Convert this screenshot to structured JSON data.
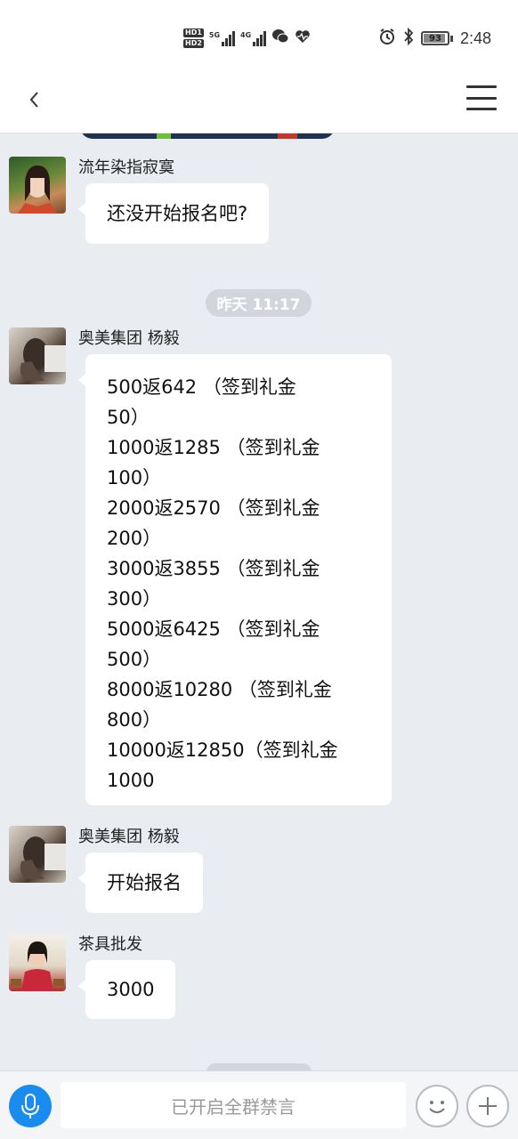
{
  "status_bar": {
    "hd1": "HD1",
    "hd2": "HD2",
    "net1": "5G",
    "net2": "4G",
    "battery": "93",
    "time": "2:48"
  },
  "nav": {
    "back_icon": "chevron-left-icon",
    "menu_icon": "hamburger-menu-icon"
  },
  "messages": [
    {
      "sender": "流年染指寂寞",
      "text": "还没开始报名吧?"
    },
    {
      "sender": "奥美集团 杨毅",
      "lines": [
        "500返642        （签到礼金",
        "50）",
        "1000返1285    （签到礼金",
        "100）",
        "2000返2570    （签到礼金",
        "200）",
        "3000返3855    （签到礼金",
        "300）",
        "5000返6425    （签到礼金",
        "500）",
        "8000返10280    （签到礼金",
        "800）",
        "10000返12850（签到礼金",
        "1000"
      ]
    },
    {
      "sender": "奥美集团 杨毅",
      "text": "开始报名"
    },
    {
      "sender": "茶具批发",
      "text": "3000"
    }
  ],
  "timestamp": "昨天 11:17",
  "input_bar": {
    "mute_text": "已开启全群禁言",
    "voice_icon": "microphone-icon",
    "emoji_icon": "smiley-icon",
    "plus_icon": "plus-icon"
  },
  "colors": {
    "accent": "#1a8cf0",
    "chat_bg": "#e9ecf1",
    "bubble": "#ffffff"
  }
}
